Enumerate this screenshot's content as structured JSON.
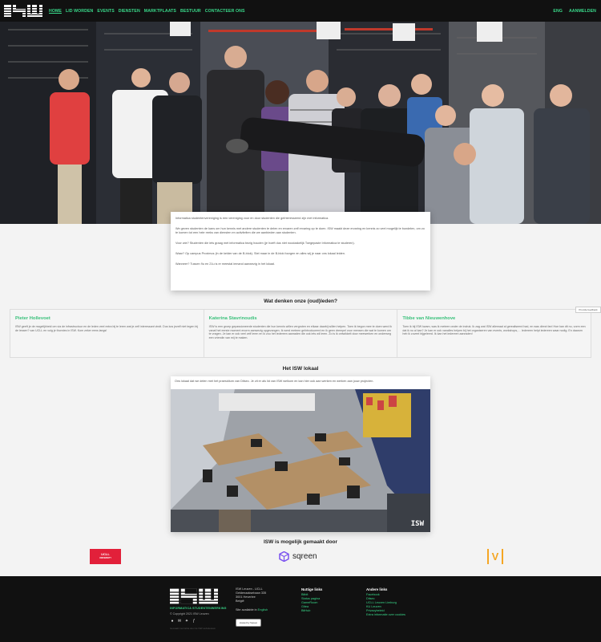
{
  "nav": {
    "brand": "ISW",
    "links": [
      "HOME",
      "LID WORDEN",
      "EVENTS",
      "DIENSTEN",
      "MARKTPLAATS",
      "BESTUUR",
      "CONTACTEER ONS"
    ],
    "lang": "ENG",
    "login": "AANMELDEN"
  },
  "intro": {
    "p1": "Informatica studentenvereniging is een vereniging voor en door studenten die geïnteresseerd zijn met informatica.",
    "p2": "We geven studenten de kans om hun kennis met andere studenten te delen en ervaren zelf ervaring op te doen. ISW maakt deze ervaring en kennis zo veel mogelijk te bundelen, om zo te komen tot een hele reeks van diensten en activiteiten die we aanbieden aan studenten.",
    "p3": "Voor wie? Studenten die iets graag met informatica bezig houden (je hoeft dus niet noodzakelijk Toegepaste Informatica te studeren).",
    "p4": "Waar? Op campus Proximus (in de kelder van de B-blok). Stel maar in de B-blok foorgen en alles wij je naar ons lokaal leiden.",
    "p5": "Wanneer? Tussen 9u en 21u is er meestal iemand aanwezig in het lokaal."
  },
  "testimonials_title": "Wat denken onze (oud)leden?",
  "testimonials": [
    {
      "name": "Pieter Hollevoet",
      "text": "ISW geeft je de mogelijkheid om via de infrastructuur en de leden veel extra bij te leren wat je zelf interessant vindt. Dus kos jezelf niet tegen bij de lessen? van UCLL en volg je thornies in ISW. Kom zeker eens langs!"
    },
    {
      "name": "Katerina Stavrinoudis",
      "text": "ISW is een groep gepassioneerde studenten die hun kennis willen vergroten en elkaar daarbij willen helpen. Toen ik begon mee te doen werd ik vanaf het eerste moment enorm aanwezig opgevangen. Ik werd meteen geïntroduceerd en ik geen drempel voor mensen die wat te komen om te vragen. Je kan er ook veel zelf leren en ik zou het iedereen aanraden die ook iets wil leren. Zo is ik ontwikkelt door meewerken en onderweg een vriendin van mij te maken."
    },
    {
      "name": "Tibbe van Nieuwenhove",
      "text": "Toen ik bij ISW kwam, was ik meteen onder de indruk. Ik zag wat ISW allemaal al gerealiseerd had, en was direct fan! Hoe kan dit nu, vorm een dat ik nu al kan? Je kan er ook vanalles helpen bij het organiseren van events, workshops,… Iedereen helpt iedereen waar nodig. En daarom heb ik zoveel bijgeleerd. Ik kan het iedereen aanraden!"
    }
  ],
  "feedback_tab": "Provide feedback",
  "lokaal": {
    "title": "Het ISW lokaal",
    "text": "Ons lokaal dat we delen met het praesidium van Ditsec. Je zit er als lid van ISW welkom en kan hier ook aan werken en werken aan jouw projecten.",
    "photo_watermark": "ISW"
  },
  "sponsors": {
    "title": "ISW is mogelijk gemaakt door",
    "ucll_line1": "UCLL",
    "ucll_line2": "UNIVERSITY",
    "sqreen": "sqreen",
    "vlogo": "V"
  },
  "footer": {
    "logo": "ISW",
    "sub": "INFORMATICA STUDENTENWERKING",
    "copyright": "© Copyright 2021 ISW Leuven",
    "tiny": "Gemaakt met liefde door de ISW websiteteam",
    "address": [
      "ISW Leuven - UCLL",
      "Geldenaaksebaan 335",
      "3001 Heverlee",
      "België"
    ],
    "available_prefix": "Site available in",
    "available_lang": "English",
    "badge": "Hosted by Sqreen",
    "nuttige_title": "Nuttige links",
    "nuttige_links": [
      "Bitbit",
      "Status pagina",
      "GameRoom",
      "Gitea",
      "BitHub"
    ],
    "andere_title": "Andere links",
    "andere_links": [
      "Facebook",
      "Ditsec",
      "UCLL Leuven Limburg",
      "KU Leuven",
      "Privacybeleid",
      "Extra informatie over cookies"
    ]
  },
  "colors": {
    "accent": "#39d98a",
    "navbar": "#111111",
    "ucll_red": "#e2203a",
    "sqreen_purple": "#7b52f0",
    "v_orange": "#f5a623"
  }
}
